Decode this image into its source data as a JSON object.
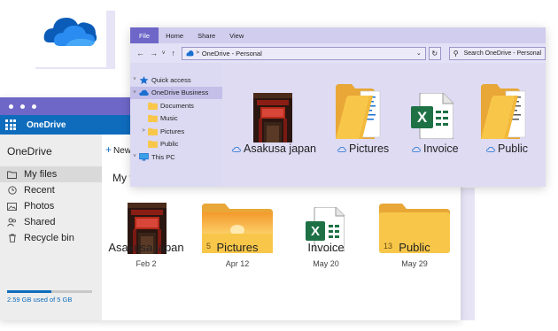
{
  "web": {
    "app_name": "OneDrive",
    "sidebar_title": "OneDrive",
    "nav": [
      {
        "label": "My files",
        "icon": "folder-icon",
        "active": true
      },
      {
        "label": "Recent",
        "icon": "clock-icon",
        "active": false
      },
      {
        "label": "Photos",
        "icon": "photo-icon",
        "active": false
      },
      {
        "label": "Shared",
        "icon": "people-icon",
        "active": false
      },
      {
        "label": "Recycle bin",
        "icon": "trash-icon",
        "active": false
      }
    ],
    "storage": {
      "text": "2.59 GB used of 5 GB",
      "used_fraction": 0.518
    },
    "new_label": "New",
    "heading": "My f",
    "files": [
      {
        "name": "Asakusa japan",
        "date": "Feb 2",
        "type": "photo"
      },
      {
        "name": "Pictures",
        "date": "Apr 12",
        "type": "folder-image",
        "count": "5"
      },
      {
        "name": "Invoice",
        "date": "May 20",
        "type": "excel"
      },
      {
        "name": "Public",
        "date": "May 29",
        "type": "folder",
        "count": "13"
      }
    ]
  },
  "explorer": {
    "tabs": [
      "File",
      "Home",
      "Share",
      "View"
    ],
    "address": "OneDrive - Personal",
    "search_placeholder": "Search OneDrive - Personal",
    "tree": [
      {
        "label": "Quick access",
        "icon": "star-icon",
        "caret": "v",
        "selected": false,
        "indent": 0
      },
      {
        "label": "OneDrive Business",
        "icon": "cloud-icon",
        "caret": "v",
        "selected": true,
        "indent": 0
      },
      {
        "label": "Documents",
        "icon": "folder-icon",
        "caret": "",
        "selected": false,
        "indent": 1
      },
      {
        "label": "Music",
        "icon": "folder-icon",
        "caret": "",
        "selected": false,
        "indent": 1
      },
      {
        "label": "Pictures",
        "icon": "folder-icon",
        "caret": ">",
        "selected": false,
        "indent": 1
      },
      {
        "label": "Public",
        "icon": "folder-icon",
        "caret": "",
        "selected": false,
        "indent": 1
      },
      {
        "label": "This PC",
        "icon": "monitor-icon",
        "caret": "v",
        "selected": false,
        "indent": 0
      }
    ],
    "items": [
      {
        "name": "Asakusa japan",
        "type": "photo"
      },
      {
        "name": "Pictures",
        "type": "folder"
      },
      {
        "name": "Invoice",
        "type": "excel"
      },
      {
        "name": "Public",
        "type": "folder"
      }
    ]
  },
  "colors": {
    "accent": "#6e67c8",
    "onedrive_blue": "#0f6cbd",
    "excel_green": "#1e7145",
    "folder_yellow": "#f8c74a"
  }
}
